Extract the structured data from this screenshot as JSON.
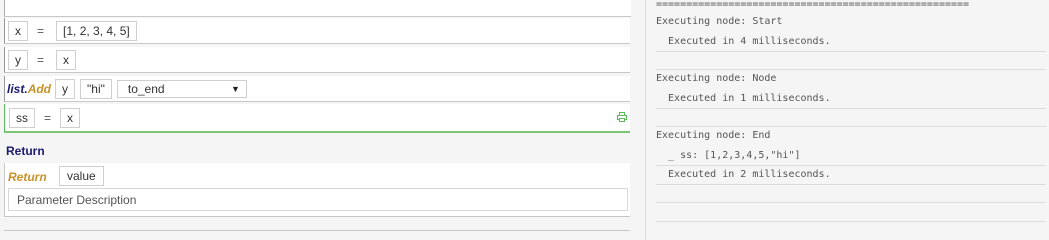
{
  "editor": {
    "rows": [
      {
        "lhs": "x",
        "op": "=",
        "rhs": "[1, 2, 3, 4, 5]"
      },
      {
        "lhs": "y",
        "op": "=",
        "rhs": "x"
      },
      {
        "call": {
          "object": "list",
          "dot": ".",
          "method": "Add"
        },
        "args": [
          "y",
          "\"hi\""
        ],
        "select": {
          "value": "to_end",
          "arrow": "▼"
        }
      },
      {
        "lhs": "ss",
        "op": "=",
        "rhs": "x"
      }
    ],
    "return_section": {
      "title": "Return",
      "keyword": "Return",
      "value": "value",
      "description": "Parameter Description"
    }
  },
  "console": {
    "top_rule": "====================================================",
    "blocks": [
      {
        "header": "Executing node: Start",
        "lines": [
          "  Executed in 4 milliseconds."
        ]
      },
      {
        "header": "Executing node: Node",
        "lines": [
          "  Executed in 1 milliseconds."
        ]
      },
      {
        "header": "Executing node: End",
        "lines": [
          "  _ ss: [1,2,3,4,5,\"hi\"]",
          "  Executed in 2 milliseconds."
        ]
      }
    ]
  },
  "icons": {
    "print": "print-icon"
  },
  "colors": {
    "accent_green": "#7cc576",
    "keyword_orange": "#c8922a",
    "title_navy": "#1a1a6e"
  }
}
